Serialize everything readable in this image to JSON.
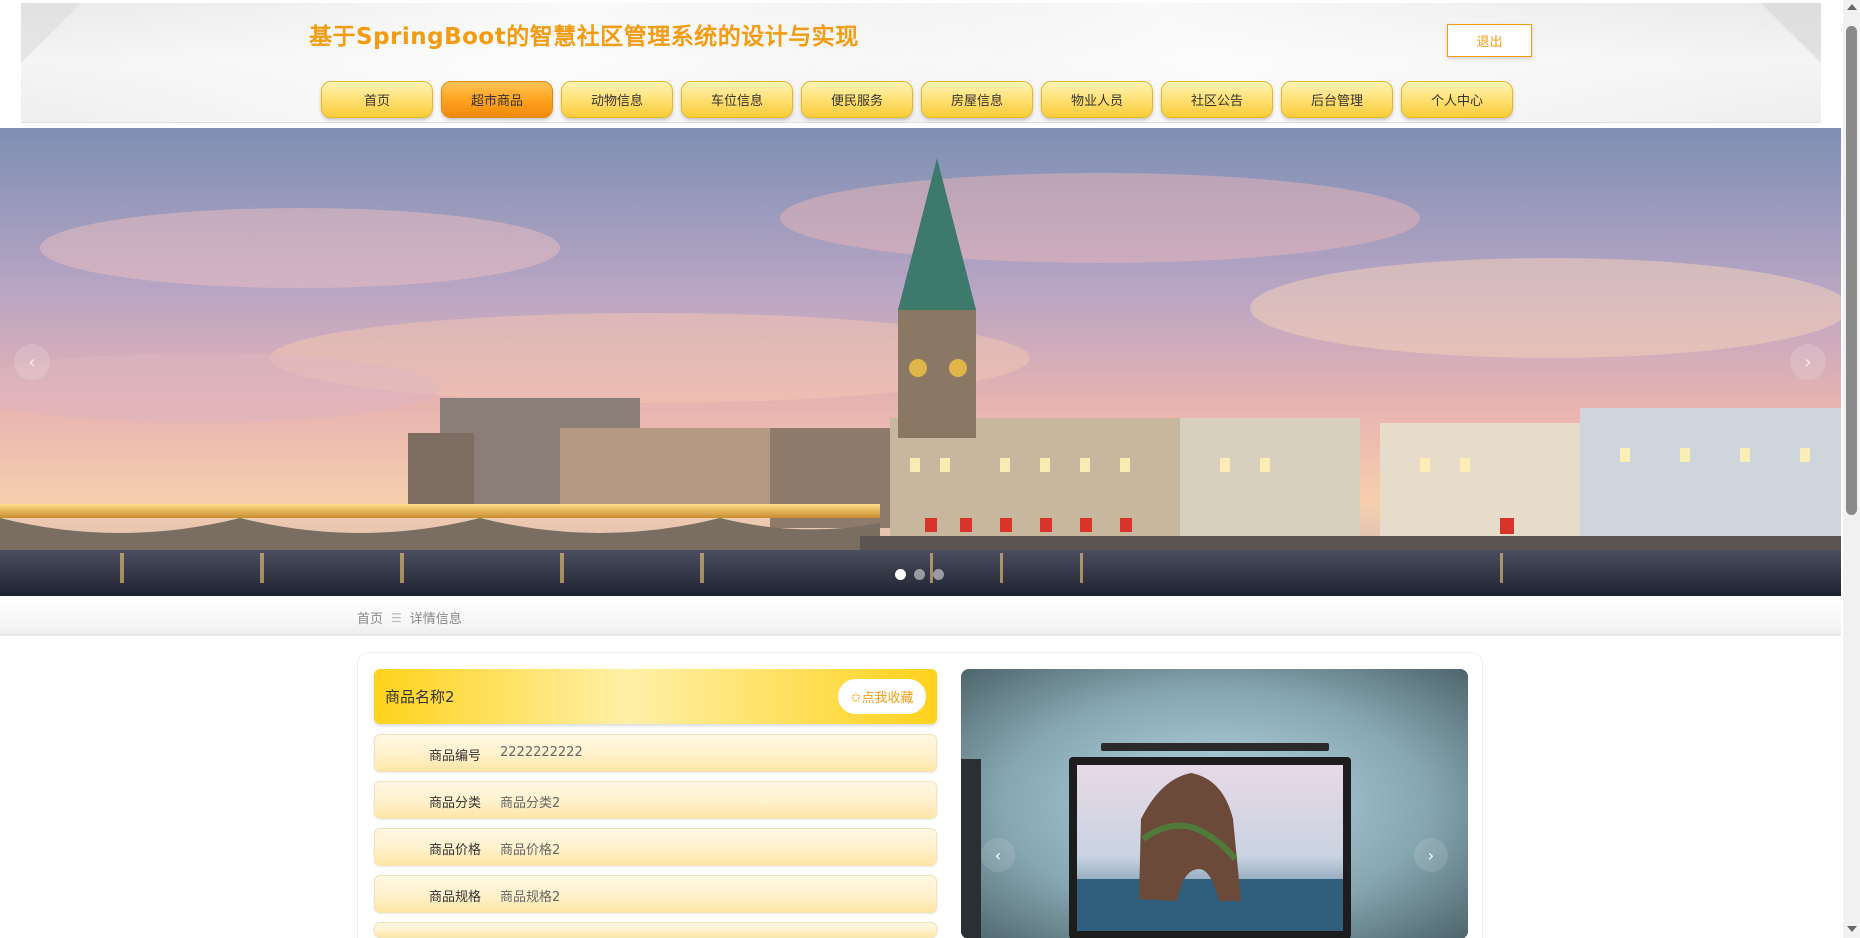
{
  "header": {
    "title": "基于SpringBoot的智慧社区管理系统的设计与实现",
    "logout_label": "退出"
  },
  "nav": {
    "items": [
      {
        "label": "首页",
        "active": false
      },
      {
        "label": "超市商品",
        "active": true
      },
      {
        "label": "动物信息",
        "active": false
      },
      {
        "label": "车位信息",
        "active": false
      },
      {
        "label": "便民服务",
        "active": false
      },
      {
        "label": "房屋信息",
        "active": false
      },
      {
        "label": "物业人员",
        "active": false
      },
      {
        "label": "社区公告",
        "active": false
      },
      {
        "label": "后台管理",
        "active": false
      },
      {
        "label": "个人中心",
        "active": false
      }
    ]
  },
  "banner": {
    "prev_icon": "‹",
    "next_icon": "›",
    "slide_count": 3,
    "active_slide": 1
  },
  "breadcrumb": {
    "home": "首页",
    "separator": "☰",
    "current": "详情信息"
  },
  "product": {
    "name": "商品名称2",
    "collect_label": "✩点我收藏",
    "fields": [
      {
        "label": "商品编号",
        "value": "2222222222"
      },
      {
        "label": "商品分类",
        "value": "商品分类2"
      },
      {
        "label": "商品价格",
        "value": "商品价格2"
      },
      {
        "label": "商品规格",
        "value": "商品规格2"
      }
    ],
    "image_prev_icon": "‹",
    "image_next_icon": "›"
  },
  "colors": {
    "accent": "#f39c12",
    "nav_active": "#ffa41f",
    "nav_normal": "#ffe27a"
  }
}
